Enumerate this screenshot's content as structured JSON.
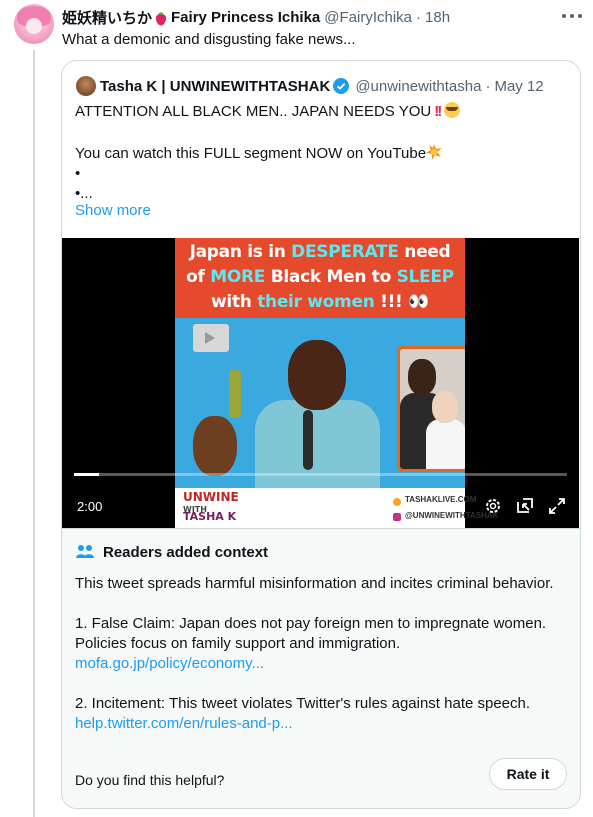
{
  "tweet": {
    "display_name": "姫妖精いちか",
    "display_name_suffix": "Fairy Princess Ichika",
    "handle": "@FairyIchika",
    "separator": "·",
    "time": "18h",
    "text": "What a demonic and disgusting fake news..."
  },
  "quoted": {
    "name": "Tasha K | UNWINEWITHTASHAK",
    "handle": "@unwinewithtasha",
    "separator": "·",
    "time": "May 12",
    "line1": "ATTENTION ALL BLACK MEN.. JAPAN NEEDS YOU",
    "line1_marks": "!!",
    "line2": "You can watch this FULL segment NOW on YouTube",
    "bullet1": "•",
    "bullet2": "•...",
    "show_more": "Show more",
    "video": {
      "banner": {
        "line1_a": "Japan is in ",
        "line1_b": "DESPERATE",
        "line1_c": " need",
        "line2_a": "of ",
        "line2_b": "MORE",
        "line2_c": " Black Men to ",
        "line2_d": "SLEEP",
        "line3_a": "with ",
        "line3_b": "their women",
        "line3_c": " !!! 👀"
      },
      "brand_top": "UNWINE",
      "brand_mid": "WITH",
      "brand_bottom": "TASHA K",
      "site": "TASHAKLIVE.COM",
      "ig": "@UNWINEWITHTASHAK",
      "duration": "2:00",
      "progress": 0.05
    }
  },
  "context": {
    "title": "Readers added context",
    "p1": "This tweet spreads harmful misinformation and incites criminal behavior.",
    "p2": "1. False Claim: Japan does not pay foreign men to impregnate women. Policies focus on family support and immigration.",
    "link1": "mofa.go.jp/policy/economy...",
    "p3": "2. Incitement: This tweet violates Twitter's rules against hate speech.",
    "link2": "help.twitter.com/en/rules-and-p...",
    "helpful_q": "Do you find this helpful?",
    "rate_button": "Rate it"
  },
  "colors": {
    "link": "#1d9bf0",
    "muted": "#536471",
    "border": "#cfd9de",
    "banner": "#e54a2d"
  }
}
